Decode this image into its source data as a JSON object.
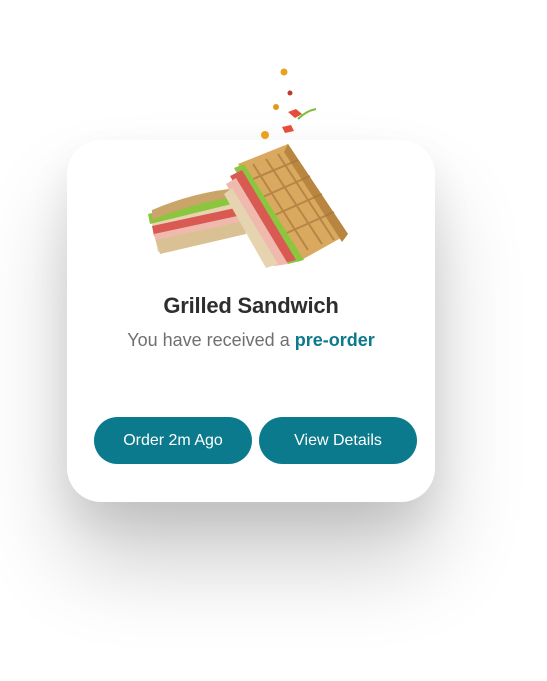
{
  "notification": {
    "title": "Grilled Sandwich",
    "message_prefix": "You have received a ",
    "message_highlight": "pre-order",
    "image_icon": "sandwich-illustration",
    "accent_color": "#0b7a8c"
  },
  "actions": {
    "order_time_label": "Order 2m Ago",
    "view_details_label": "View Details"
  }
}
